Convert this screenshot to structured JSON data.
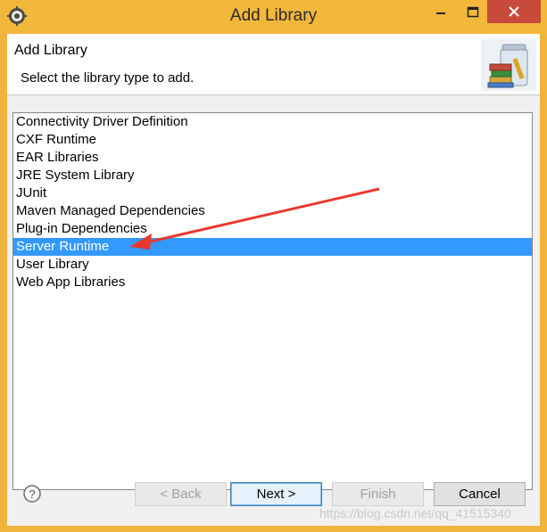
{
  "window": {
    "title": "Add Library"
  },
  "header": {
    "title": "Add Library",
    "description": "Select the library type to add."
  },
  "library_list": {
    "items": [
      {
        "label": "Connectivity Driver Definition",
        "selected": false
      },
      {
        "label": "CXF Runtime",
        "selected": false
      },
      {
        "label": "EAR Libraries",
        "selected": false
      },
      {
        "label": "JRE System Library",
        "selected": false
      },
      {
        "label": "JUnit",
        "selected": false
      },
      {
        "label": "Maven Managed Dependencies",
        "selected": false
      },
      {
        "label": "Plug-in Dependencies",
        "selected": false
      },
      {
        "label": "Server Runtime",
        "selected": true
      },
      {
        "label": "User Library",
        "selected": false
      },
      {
        "label": "Web App Libraries",
        "selected": false
      }
    ]
  },
  "buttons": {
    "back": "< Back",
    "next": "Next >",
    "finish": "Finish",
    "cancel": "Cancel"
  },
  "watermark": "https://blog.csdn.net/qq_41515340",
  "colors": {
    "titlebar": "#f3b73c",
    "selection": "#3399ff",
    "close": "#c74a3a",
    "annotation_arrow": "#e8382e"
  },
  "icons": {
    "app": "eclipse-gear-icon",
    "banner": "library-books-jar-icon",
    "help": "help-question-icon"
  }
}
